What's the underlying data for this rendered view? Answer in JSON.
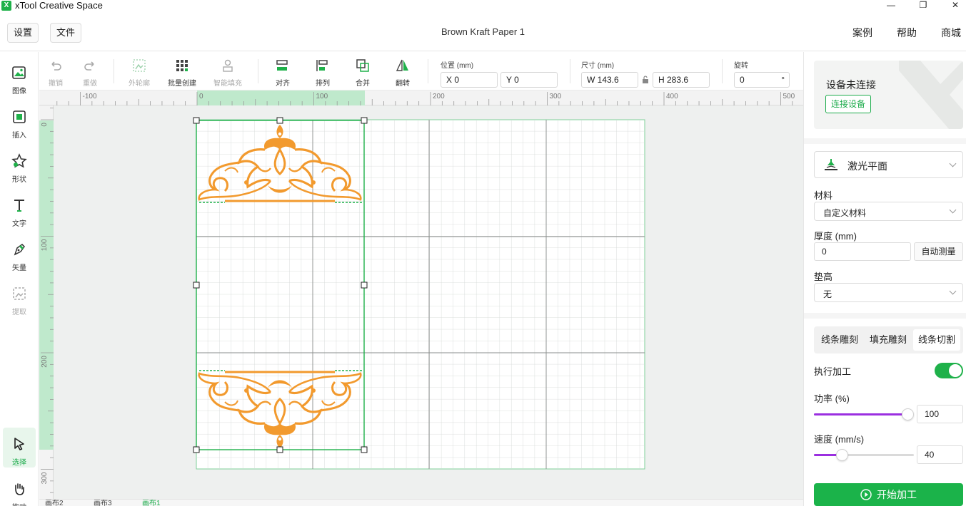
{
  "app": {
    "title": "xTool Creative Space",
    "logo_text": "X",
    "window_controls": {
      "minimize": "—",
      "restore": "❐",
      "close": "✕"
    }
  },
  "header": {
    "settings_label": "设置",
    "file_label": "文件",
    "document_title": "Brown Kraft Paper 1",
    "links": {
      "cases": "案例",
      "help": "帮助",
      "store": "商城"
    }
  },
  "left_tools": [
    {
      "label": "图像",
      "icon": "image-icon"
    },
    {
      "label": "插入",
      "icon": "insert-icon"
    },
    {
      "label": "形状",
      "icon": "shape-star-icon"
    },
    {
      "label": "文字",
      "icon": "text-icon"
    },
    {
      "label": "矢量",
      "icon": "pen-vector-icon"
    },
    {
      "label": "提取",
      "icon": "extract-icon"
    },
    {
      "label": "选择",
      "icon": "select-cursor-icon"
    },
    {
      "label": "拖动",
      "icon": "hand-drag-icon"
    }
  ],
  "toolbar": {
    "undo": "撤销",
    "redo": "重做",
    "outline": "外轮廓",
    "batch_create": "批量创建",
    "smart_fill": "智能填充",
    "align": "对齐",
    "arrange": "排列",
    "combine": "合并",
    "flip": "翻转",
    "position": {
      "title": "位置 (mm)",
      "x": "X 0",
      "y": "Y 0"
    },
    "size": {
      "title": "尺寸 (mm)",
      "w": "W 143.6",
      "h": "H 283.6"
    },
    "rotate": {
      "title": "旋转",
      "value": "0",
      "unit": "°"
    }
  },
  "rulers": {
    "horizontal_labels": [
      "-100",
      "0",
      "100",
      "200",
      "300",
      "400",
      "500"
    ],
    "vertical_labels": [
      "0",
      "100",
      "200",
      "300"
    ]
  },
  "page_tabs": [
    "画布2",
    "画布3",
    "画布1"
  ],
  "right_panel": {
    "device_status": "设备未连接",
    "connect_button": "连接设备",
    "work_mode": "激光平面",
    "material_label": "材料",
    "material_value": "自定义材料",
    "thickness_label": "厚度 (mm)",
    "thickness_value": "0",
    "auto_measure": "自动测量",
    "riser_label": "垫高",
    "riser_value": "无",
    "mode_tabs": [
      "线条雕刻",
      "填充雕刻",
      "线条切割"
    ],
    "active_mode_tab": "线条切割",
    "execute_label": "执行加工",
    "execute_on": true,
    "power_label": "功率 (%)",
    "power_value": "100",
    "power_level": 1.0,
    "speed_label": "速度 (mm/s)",
    "speed_value": "40",
    "speed_level": 0.28,
    "start_button": "开始加工"
  },
  "colors": {
    "accent": "#1bb34a",
    "design_orange": "#f29a2e",
    "slider_purple": "#9b2fe0"
  }
}
